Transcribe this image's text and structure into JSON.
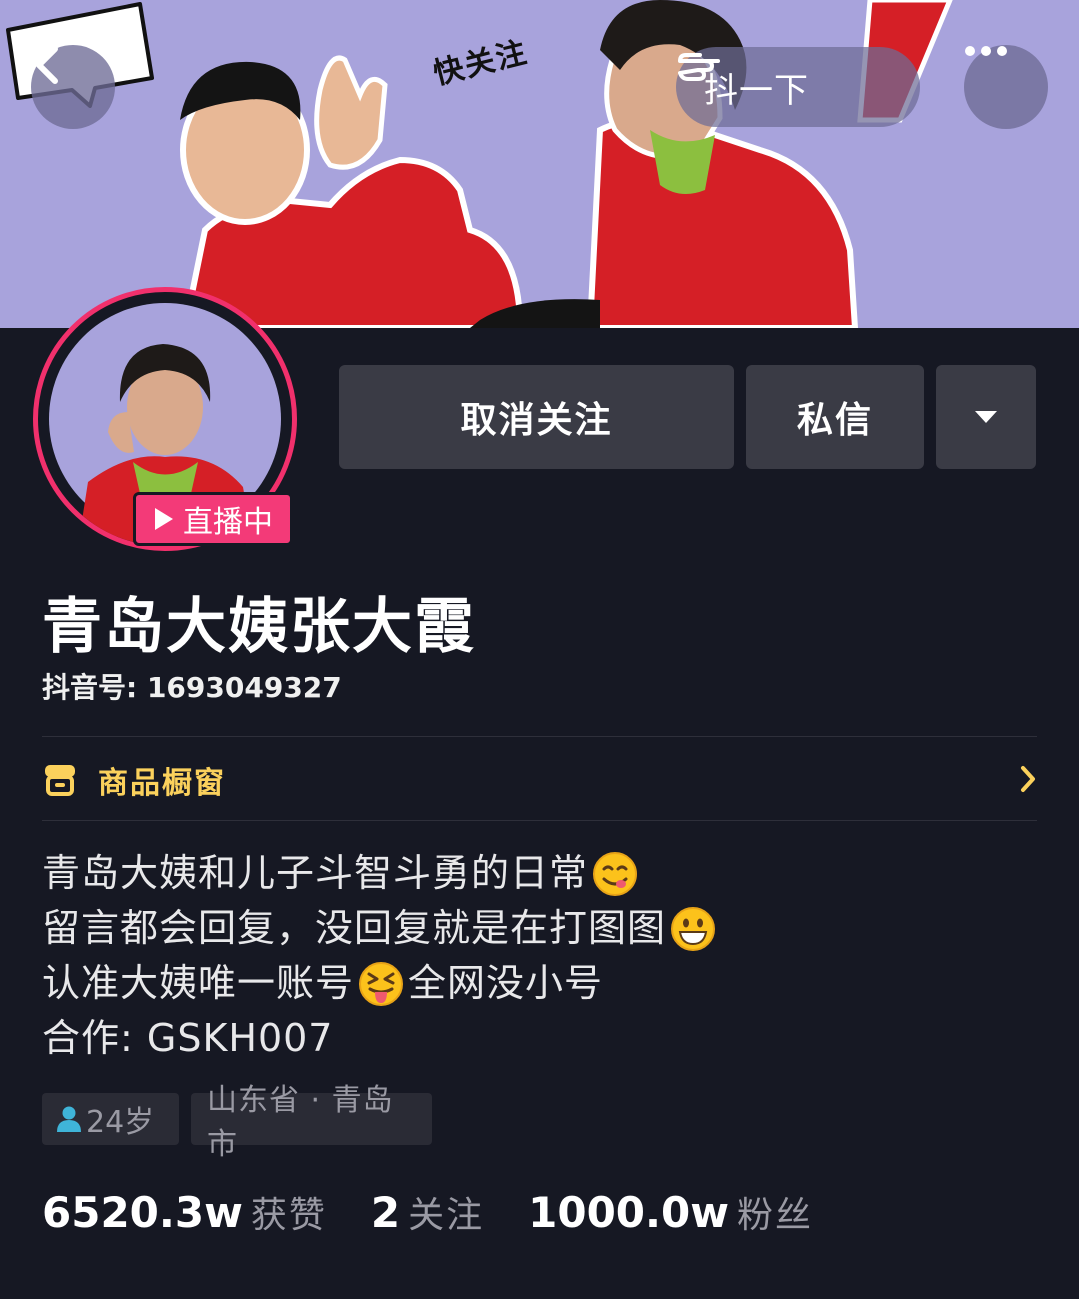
{
  "banner": {
    "speech_bubble_text": "快关注",
    "doudou_label": "抖一下"
  },
  "profile": {
    "live_badge_label": "直播中",
    "nickname": "青岛大姨张大霞",
    "douyin_id": "抖音号: 1693049327"
  },
  "actions": {
    "unfollow_label": "取消关注",
    "message_label": "私信"
  },
  "shop": {
    "label": "商品橱窗"
  },
  "bio": {
    "lines": [
      {
        "text": "青岛大姨和儿子斗智斗勇的日常",
        "emoji": "yum-emoji",
        "after": ""
      },
      {
        "text": "留言都会回复，没回复就是在打图图",
        "emoji": "grin-emoji",
        "after": ""
      },
      {
        "text": "认准大姨唯一账号",
        "emoji": "tongue-emoji",
        "after": "全网没小号"
      },
      {
        "text": "合作: GSKH007",
        "emoji": "",
        "after": ""
      }
    ]
  },
  "tags": {
    "age": "24岁",
    "location": "山东省 · 青岛市"
  },
  "stats": {
    "likes_value": "6520.3w",
    "likes_label": "获赞",
    "following_value": "2",
    "following_label": "关注",
    "followers_value": "1000.0w",
    "followers_label": "粉丝"
  },
  "colors": {
    "background": "#161823",
    "banner": "#a8a3dc",
    "live_pink": "#f33a78",
    "shop_yellow": "#fbd15c",
    "button_gray": "#3a3b45"
  }
}
